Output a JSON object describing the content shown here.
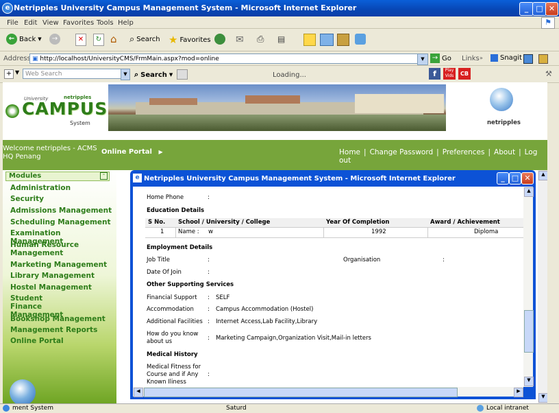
{
  "window": {
    "title": "Netripples University Campus Management System - Microsoft Internet Explorer"
  },
  "menu": [
    "File",
    "Edit",
    "View",
    "Favorites",
    "Tools",
    "Help"
  ],
  "toolbar": {
    "back": "Back",
    "search": "Search",
    "favorites": "Favorites"
  },
  "address": {
    "label": "Address",
    "url": "http://localhost/UniversityCMS/FrmMain.aspx?mod=online",
    "go": "Go",
    "links": "Links",
    "snagit": "Snagit"
  },
  "searchbar": {
    "placeholder": "Web Search",
    "search": "Search",
    "loading": "Loading..."
  },
  "header": {
    "logo_university": "University",
    "logo_netripples": "netripples",
    "logo_campus": "CAMPUS",
    "logo_system": "System",
    "logo_right": "netripples"
  },
  "greenbar": {
    "welcome": "Welcome netripples - ACMS HQ Penang",
    "online_portal": "Online Portal",
    "nav": [
      "Home",
      "Change Password",
      "Preferences",
      "About",
      "Log out"
    ]
  },
  "sidebar": {
    "heading": "Modules",
    "items": [
      "Administration",
      "Security",
      "Admissions Management",
      "Scheduling Management",
      "Examination Management",
      "Human Resource Management",
      "Marketing Management",
      "Library Management",
      "Hostel Management",
      "Student Finance Management",
      "Bookshop Management",
      "Management Reports",
      "Online Portal"
    ]
  },
  "popup": {
    "title": "Netripples University Campus Management System - Microsoft Internet Explorer",
    "home_phone": "Home Phone",
    "colon": ":",
    "education_heading": "Education Details",
    "edu_headers": [
      "S No.",
      "School / University / College",
      "Year Of Completion",
      "Award / Achievement"
    ],
    "edu_row": {
      "sno": "1",
      "name_label": "Name :",
      "name": "w",
      "year": "1992",
      "award": "Diploma"
    },
    "employment_heading": "Employment Details",
    "job_title": "Job Title",
    "organisation": "Organisation",
    "date_of_join": "Date Of Join",
    "services_heading": "Other Supporting Services",
    "financial_support": "Financial Support",
    "financial_support_value": "SELF",
    "accommodation": "Accommodation",
    "accommodation_value": "Campus Accommodation (Hostel)",
    "additional_facilities": "Additional Facilities",
    "additional_facilities_value": "Internet Access,Lab Facility,Library",
    "how_know": "How do you know about us",
    "how_know_value": "Marketing Campaign,Organization Visit,Mail-in letters",
    "medical_heading": "Medical History",
    "medical_fitness": "Medical Fitness for Course and if Any Known Iliness"
  },
  "status": {
    "left": "ment System",
    "middle": "Saturd",
    "right": "Local intranet"
  }
}
